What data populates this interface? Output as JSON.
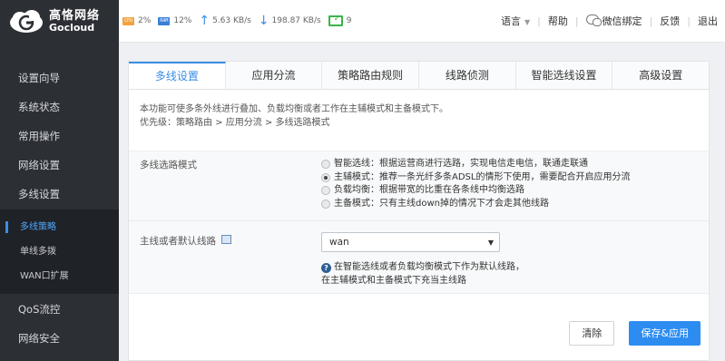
{
  "brand": {
    "name_cn": "高恪网络",
    "name_en": "Gocloud"
  },
  "sidebar": {
    "items_top": [
      {
        "label": "设置向导"
      },
      {
        "label": "系统状态"
      },
      {
        "label": "常用操作"
      },
      {
        "label": "网络设置"
      },
      {
        "label": "多线设置"
      }
    ],
    "sub_items": [
      {
        "label": "多线策略"
      },
      {
        "label": "单线多拨"
      },
      {
        "label": "WAN口扩展"
      }
    ],
    "items_bottom": [
      {
        "label": "QoS流控"
      },
      {
        "label": "网络安全"
      }
    ]
  },
  "status": {
    "cpu_chip": "CPU",
    "cpu": "2%",
    "ram_chip": "RAM",
    "ram": "12%",
    "upload": "5.63 KB/s",
    "download": "198.87 KB/s",
    "devices": "9"
  },
  "topnav": {
    "language": "语言",
    "help": "帮助",
    "wechat": "微信绑定",
    "feedback": "反馈",
    "logout": "退出"
  },
  "tabs": [
    {
      "label": "多线设置"
    },
    {
      "label": "应用分流"
    },
    {
      "label": "策略路由规则"
    },
    {
      "label": "线路侦测"
    },
    {
      "label": "智能选线设置"
    },
    {
      "label": "高级设置"
    }
  ],
  "description": {
    "line1": "本功能可使多条外线进行叠加、负载均衡或者工作在主辅模式和主备模式下。",
    "line2": "优先级：策略路由 > 应用分流 > 多线选路模式"
  },
  "mode": {
    "label": "多线选路模式",
    "options": [
      {
        "label": "智能选线：根据运营商进行选路，实现电信走电信，联通走联通"
      },
      {
        "label": "主辅模式：推荐一条光纤多条ADSL的情形下使用，需要配合开启应用分流"
      },
      {
        "label": "负载均衡：根据带宽的比重在各条线中均衡选路"
      },
      {
        "label": "主备模式：只有主线down掉的情况下才会走其他线路"
      }
    ],
    "selected_index": 1
  },
  "default_line": {
    "label": "主线或者默认线路",
    "value": "wan",
    "hint_line1": "在智能选线或者负载均衡模式下作为默认线路，",
    "hint_line2": "在主辅模式和主备模式下充当主线路"
  },
  "buttons": {
    "clear": "清除",
    "save": "保存&应用"
  }
}
